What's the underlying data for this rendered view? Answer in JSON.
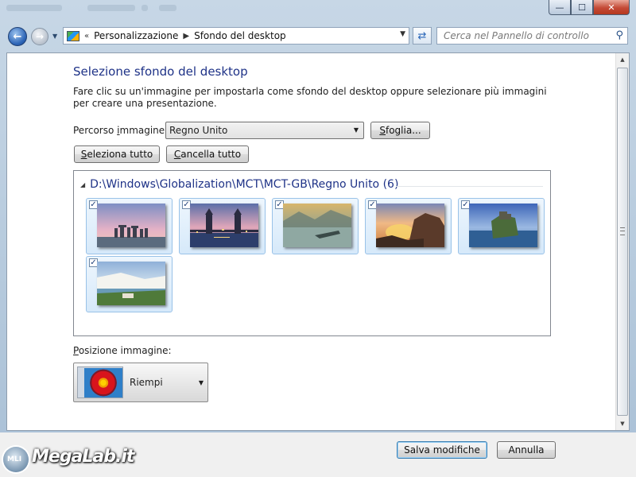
{
  "address_bar": {
    "crumbs": [
      "Personalizzazione",
      "Sfondo del desktop"
    ],
    "search_placeholder": "Cerca nel Pannello di controllo"
  },
  "page": {
    "title": "Selezione sfondo del desktop",
    "description": "Fare clic su un'immagine per impostarla come sfondo del desktop oppure selezionare più immagini per creare una presentazione.",
    "path_label_before": "Percorso ",
    "path_label_accel": "i",
    "path_label_after": "mmagine:",
    "path_value": "Regno Unito",
    "browse_accel": "S",
    "browse_rest": "foglia...",
    "select_all_accel": "S",
    "select_all_rest": "eleziona tutto",
    "clear_all_accel": "C",
    "clear_all_rest": "ancella tutto"
  },
  "gallery": {
    "group_title": "D:\\Windows\\Globalization\\MCT\\MCT-GB\\Regno Unito (6)",
    "images": [
      {
        "name": "stonehenge",
        "checked": true
      },
      {
        "name": "tower-bridge",
        "checked": true
      },
      {
        "name": "lake-district",
        "checked": true
      },
      {
        "name": "coastal-rocks",
        "checked": true
      },
      {
        "name": "castle-cliff",
        "checked": true
      },
      {
        "name": "white-cliffs",
        "checked": true
      }
    ]
  },
  "position": {
    "label_accel": "P",
    "label_rest": "osizione immagine:",
    "value": "Riempi"
  },
  "footer": {
    "save_label": "Salva modifiche",
    "cancel_label": "Annulla"
  },
  "watermark": {
    "badge": "MLI",
    "text": "MegaLab.it"
  }
}
